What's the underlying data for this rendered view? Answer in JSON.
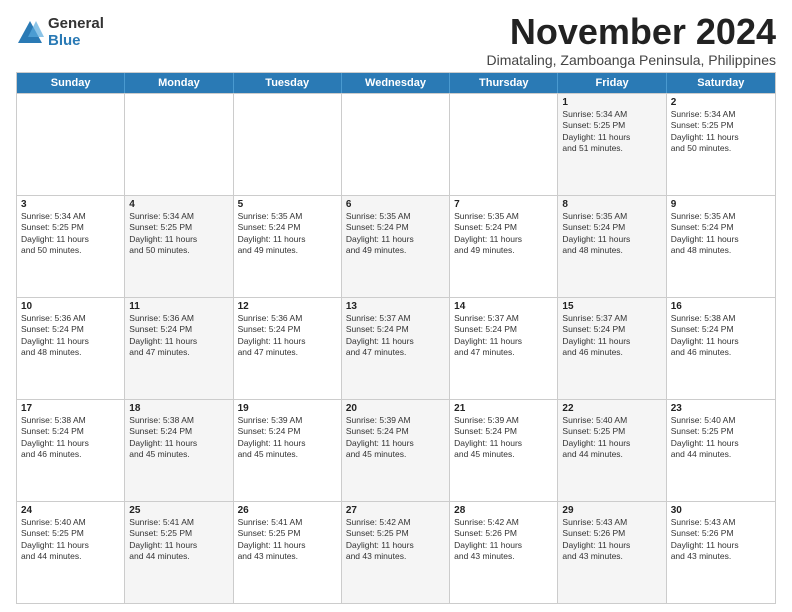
{
  "logo": {
    "general": "General",
    "blue": "Blue"
  },
  "title": "November 2024",
  "location": "Dimataling, Zamboanga Peninsula, Philippines",
  "header_days": [
    "Sunday",
    "Monday",
    "Tuesday",
    "Wednesday",
    "Thursday",
    "Friday",
    "Saturday"
  ],
  "rows": [
    [
      {
        "day": "",
        "lines": [],
        "shaded": false
      },
      {
        "day": "",
        "lines": [],
        "shaded": false
      },
      {
        "day": "",
        "lines": [],
        "shaded": false
      },
      {
        "day": "",
        "lines": [],
        "shaded": false
      },
      {
        "day": "",
        "lines": [],
        "shaded": false
      },
      {
        "day": "1",
        "lines": [
          "Sunrise: 5:34 AM",
          "Sunset: 5:25 PM",
          "Daylight: 11 hours",
          "and 51 minutes."
        ],
        "shaded": true
      },
      {
        "day": "2",
        "lines": [
          "Sunrise: 5:34 AM",
          "Sunset: 5:25 PM",
          "Daylight: 11 hours",
          "and 50 minutes."
        ],
        "shaded": false
      }
    ],
    [
      {
        "day": "3",
        "lines": [
          "Sunrise: 5:34 AM",
          "Sunset: 5:25 PM",
          "Daylight: 11 hours",
          "and 50 minutes."
        ],
        "shaded": false
      },
      {
        "day": "4",
        "lines": [
          "Sunrise: 5:34 AM",
          "Sunset: 5:25 PM",
          "Daylight: 11 hours",
          "and 50 minutes."
        ],
        "shaded": true
      },
      {
        "day": "5",
        "lines": [
          "Sunrise: 5:35 AM",
          "Sunset: 5:24 PM",
          "Daylight: 11 hours",
          "and 49 minutes."
        ],
        "shaded": false
      },
      {
        "day": "6",
        "lines": [
          "Sunrise: 5:35 AM",
          "Sunset: 5:24 PM",
          "Daylight: 11 hours",
          "and 49 minutes."
        ],
        "shaded": true
      },
      {
        "day": "7",
        "lines": [
          "Sunrise: 5:35 AM",
          "Sunset: 5:24 PM",
          "Daylight: 11 hours",
          "and 49 minutes."
        ],
        "shaded": false
      },
      {
        "day": "8",
        "lines": [
          "Sunrise: 5:35 AM",
          "Sunset: 5:24 PM",
          "Daylight: 11 hours",
          "and 48 minutes."
        ],
        "shaded": true
      },
      {
        "day": "9",
        "lines": [
          "Sunrise: 5:35 AM",
          "Sunset: 5:24 PM",
          "Daylight: 11 hours",
          "and 48 minutes."
        ],
        "shaded": false
      }
    ],
    [
      {
        "day": "10",
        "lines": [
          "Sunrise: 5:36 AM",
          "Sunset: 5:24 PM",
          "Daylight: 11 hours",
          "and 48 minutes."
        ],
        "shaded": false
      },
      {
        "day": "11",
        "lines": [
          "Sunrise: 5:36 AM",
          "Sunset: 5:24 PM",
          "Daylight: 11 hours",
          "and 47 minutes."
        ],
        "shaded": true
      },
      {
        "day": "12",
        "lines": [
          "Sunrise: 5:36 AM",
          "Sunset: 5:24 PM",
          "Daylight: 11 hours",
          "and 47 minutes."
        ],
        "shaded": false
      },
      {
        "day": "13",
        "lines": [
          "Sunrise: 5:37 AM",
          "Sunset: 5:24 PM",
          "Daylight: 11 hours",
          "and 47 minutes."
        ],
        "shaded": true
      },
      {
        "day": "14",
        "lines": [
          "Sunrise: 5:37 AM",
          "Sunset: 5:24 PM",
          "Daylight: 11 hours",
          "and 47 minutes."
        ],
        "shaded": false
      },
      {
        "day": "15",
        "lines": [
          "Sunrise: 5:37 AM",
          "Sunset: 5:24 PM",
          "Daylight: 11 hours",
          "and 46 minutes."
        ],
        "shaded": true
      },
      {
        "day": "16",
        "lines": [
          "Sunrise: 5:38 AM",
          "Sunset: 5:24 PM",
          "Daylight: 11 hours",
          "and 46 minutes."
        ],
        "shaded": false
      }
    ],
    [
      {
        "day": "17",
        "lines": [
          "Sunrise: 5:38 AM",
          "Sunset: 5:24 PM",
          "Daylight: 11 hours",
          "and 46 minutes."
        ],
        "shaded": false
      },
      {
        "day": "18",
        "lines": [
          "Sunrise: 5:38 AM",
          "Sunset: 5:24 PM",
          "Daylight: 11 hours",
          "and 45 minutes."
        ],
        "shaded": true
      },
      {
        "day": "19",
        "lines": [
          "Sunrise: 5:39 AM",
          "Sunset: 5:24 PM",
          "Daylight: 11 hours",
          "and 45 minutes."
        ],
        "shaded": false
      },
      {
        "day": "20",
        "lines": [
          "Sunrise: 5:39 AM",
          "Sunset: 5:24 PM",
          "Daylight: 11 hours",
          "and 45 minutes."
        ],
        "shaded": true
      },
      {
        "day": "21",
        "lines": [
          "Sunrise: 5:39 AM",
          "Sunset: 5:24 PM",
          "Daylight: 11 hours",
          "and 45 minutes."
        ],
        "shaded": false
      },
      {
        "day": "22",
        "lines": [
          "Sunrise: 5:40 AM",
          "Sunset: 5:25 PM",
          "Daylight: 11 hours",
          "and 44 minutes."
        ],
        "shaded": true
      },
      {
        "day": "23",
        "lines": [
          "Sunrise: 5:40 AM",
          "Sunset: 5:25 PM",
          "Daylight: 11 hours",
          "and 44 minutes."
        ],
        "shaded": false
      }
    ],
    [
      {
        "day": "24",
        "lines": [
          "Sunrise: 5:40 AM",
          "Sunset: 5:25 PM",
          "Daylight: 11 hours",
          "and 44 minutes."
        ],
        "shaded": false
      },
      {
        "day": "25",
        "lines": [
          "Sunrise: 5:41 AM",
          "Sunset: 5:25 PM",
          "Daylight: 11 hours",
          "and 44 minutes."
        ],
        "shaded": true
      },
      {
        "day": "26",
        "lines": [
          "Sunrise: 5:41 AM",
          "Sunset: 5:25 PM",
          "Daylight: 11 hours",
          "and 43 minutes."
        ],
        "shaded": false
      },
      {
        "day": "27",
        "lines": [
          "Sunrise: 5:42 AM",
          "Sunset: 5:25 PM",
          "Daylight: 11 hours",
          "and 43 minutes."
        ],
        "shaded": true
      },
      {
        "day": "28",
        "lines": [
          "Sunrise: 5:42 AM",
          "Sunset: 5:26 PM",
          "Daylight: 11 hours",
          "and 43 minutes."
        ],
        "shaded": false
      },
      {
        "day": "29",
        "lines": [
          "Sunrise: 5:43 AM",
          "Sunset: 5:26 PM",
          "Daylight: 11 hours",
          "and 43 minutes."
        ],
        "shaded": true
      },
      {
        "day": "30",
        "lines": [
          "Sunrise: 5:43 AM",
          "Sunset: 5:26 PM",
          "Daylight: 11 hours",
          "and 43 minutes."
        ],
        "shaded": false
      }
    ]
  ]
}
